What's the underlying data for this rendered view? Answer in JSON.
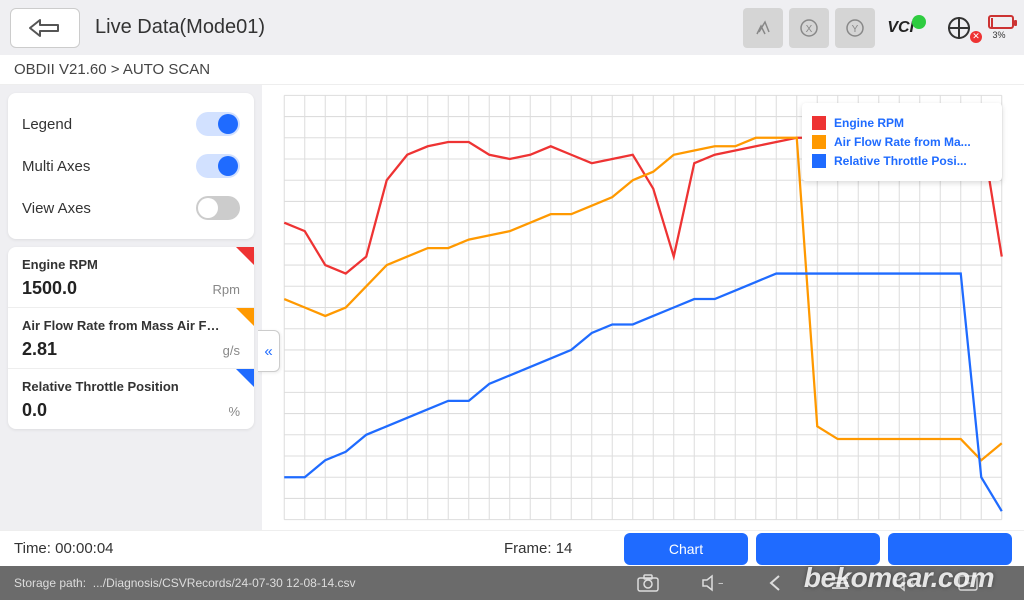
{
  "header": {
    "title": "Live Data(Mode01)",
    "battery_pct": "3%"
  },
  "breadcrumb": "OBDII V21.60 > AUTO SCAN",
  "options": {
    "legend_label": "Legend",
    "legend_on": true,
    "multiaxes_label": "Multi Axes",
    "multiaxes_on": true,
    "viewaxes_label": "View Axes",
    "viewaxes_on": false
  },
  "params": [
    {
      "name": "Engine RPM",
      "value": "1500.0",
      "unit": "Rpm",
      "color": "red"
    },
    {
      "name": "Air Flow Rate from Mass Air Flow S...",
      "value": "2.81",
      "unit": "g/s",
      "color": "orange"
    },
    {
      "name": "Relative Throttle Position",
      "value": "0.0",
      "unit": "%",
      "color": "blue"
    }
  ],
  "legend": {
    "items": [
      {
        "color": "#e33",
        "label": "Engine RPM"
      },
      {
        "color": "#f90",
        "label": "Air Flow Rate from Ma..."
      },
      {
        "color": "#1f6bff",
        "label": "Relative Throttle Posi..."
      }
    ]
  },
  "footer": {
    "time_label": "Time:",
    "time_value": "00:00:04",
    "frame_label": "Frame:",
    "frame_value": "14",
    "chart_btn": "Chart",
    "storage_label": "Storage path:",
    "storage_path": ".../Diagnosis/CSVRecords/24-07-30 12-08-14.csv"
  },
  "brand": "bekomcar.com",
  "chart_data": {
    "type": "line",
    "title": "",
    "xlabel": "",
    "ylabel": "",
    "x": [
      0,
      2,
      4,
      6,
      8,
      10,
      12,
      14,
      16,
      18,
      20,
      22,
      24,
      26,
      28,
      30,
      32,
      34,
      36,
      38,
      40,
      42,
      44,
      46,
      48,
      50,
      52,
      54,
      56,
      58,
      60,
      62,
      64,
      66,
      68,
      70
    ],
    "series": [
      {
        "name": "Engine RPM",
        "color": "#e33",
        "ylim": [
          0,
          100
        ],
        "values": [
          70,
          68,
          60,
          58,
          62,
          80,
          86,
          88,
          89,
          89,
          86,
          85,
          86,
          88,
          86,
          84,
          85,
          86,
          78,
          62,
          84,
          86,
          87,
          88,
          89,
          90,
          90,
          91,
          91,
          92,
          86,
          91,
          91,
          92,
          92,
          62
        ]
      },
      {
        "name": "Air Flow Rate from Mass Air Flow Sensor",
        "color": "#f90",
        "ylim": [
          0,
          100
        ],
        "values": [
          52,
          50,
          48,
          50,
          55,
          60,
          62,
          64,
          64,
          66,
          67,
          68,
          70,
          72,
          72,
          74,
          76,
          80,
          82,
          86,
          87,
          88,
          88,
          90,
          90,
          90,
          22,
          19,
          19,
          19,
          19,
          19,
          19,
          19,
          14,
          18
        ]
      },
      {
        "name": "Relative Throttle Position",
        "color": "#1f6bff",
        "ylim": [
          0,
          100
        ],
        "values": [
          10,
          10,
          14,
          16,
          20,
          22,
          24,
          26,
          28,
          28,
          32,
          34,
          36,
          38,
          40,
          44,
          46,
          46,
          48,
          50,
          52,
          52,
          54,
          56,
          58,
          58,
          58,
          58,
          58,
          58,
          58,
          58,
          58,
          58,
          10,
          2
        ]
      }
    ],
    "grid": {
      "h": true,
      "v": true
    },
    "legend_position": "top-right"
  }
}
